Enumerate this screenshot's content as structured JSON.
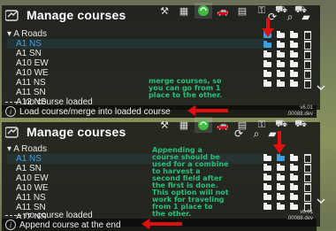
{
  "toolbar": {
    "icons": [
      "hammer-icon",
      "grid-icon",
      "image-icon",
      "car-icon",
      "car-icon",
      "map-icon",
      "key-icon",
      "tractor-icon",
      "truck-icon"
    ],
    "selected_index": 3
  },
  "panels": [
    {
      "title": "Manage courses",
      "list": [
        {
          "label": "A Roads",
          "type": "folder"
        },
        {
          "label": "A1 NS",
          "type": "course",
          "selected": true
        },
        {
          "label": "A1 SN",
          "type": "course"
        },
        {
          "label": "A10 EW",
          "type": "course"
        },
        {
          "label": "A10 WE",
          "type": "course"
        },
        {
          "label": "A11 NS",
          "type": "course"
        },
        {
          "label": "A11 SN",
          "type": "course"
        },
        {
          "label": "A12 NS",
          "type": "course"
        }
      ],
      "status": "no course loaded",
      "tooltip": "Load course/merge into loaded course",
      "version": "v6.01",
      "build": ".00088.dev",
      "annotation": "merge courses, so\nyou can go from 1\nplace to the other."
    },
    {
      "title": "Manage courses",
      "list": [
        {
          "label": "A Roads",
          "type": "folder"
        },
        {
          "label": "A1 NS",
          "type": "course",
          "selected": true
        },
        {
          "label": "A1 SN",
          "type": "course"
        },
        {
          "label": "A10 EW",
          "type": "course"
        },
        {
          "label": "A10 WE",
          "type": "course"
        },
        {
          "label": "A11 NS",
          "type": "course"
        },
        {
          "label": "A11 SN",
          "type": "course"
        },
        {
          "label": "A12 NS",
          "type": "course"
        }
      ],
      "status": "no course loaded",
      "tooltip": "Append course at the end",
      "version": "v6.01",
      "build": ".00088.dev",
      "annotation": "Appending a\ncourse should be\nused for a combine\nto harvest a\nsecond field after\nthe first is done.\nThis option will not\nwork for traveling\nfrom 1 place to\nthe other."
    }
  ],
  "colors": {
    "selected": "#3aa0e0",
    "annotation": "#22c07a",
    "arrow": "#e01010"
  }
}
